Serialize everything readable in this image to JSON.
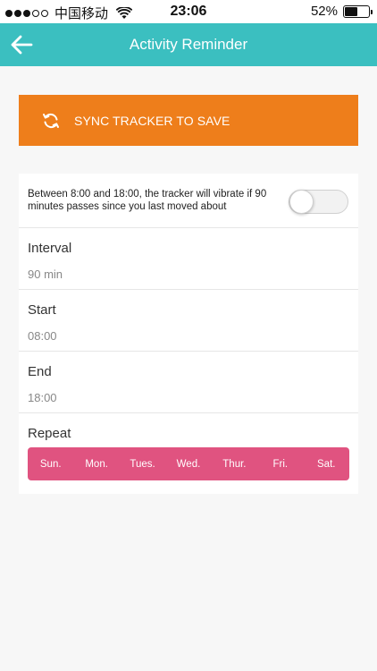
{
  "status_bar": {
    "carrier": "中国移动",
    "time": "23:06",
    "battery": "52%",
    "battery_level": 0.52,
    "signal_bars_filled": 3,
    "signal_bars_total": 5
  },
  "header": {
    "title": "Activity Reminder",
    "back_icon": "arrow-left-icon",
    "background_color": "#3bbfc0"
  },
  "sync_banner": {
    "label": "SYNC TRACKER TO SAVE",
    "icon": "sync-icon",
    "background_color": "#ee7e1b"
  },
  "reminder": {
    "description": "Between 8:00 and 18:00, the tracker will vibrate if 90 minutes passes since you last moved about",
    "enabled": false
  },
  "settings": {
    "interval": {
      "label": "Interval",
      "value": "90 min"
    },
    "start": {
      "label": "Start",
      "value": "08:00"
    },
    "end": {
      "label": "End",
      "value": "18:00"
    }
  },
  "repeat": {
    "label": "Repeat",
    "days": [
      "Sun.",
      "Mon.",
      "Tues.",
      "Wed.",
      "Thur.",
      "Fri.",
      "Sat."
    ],
    "color": "#e05380"
  }
}
